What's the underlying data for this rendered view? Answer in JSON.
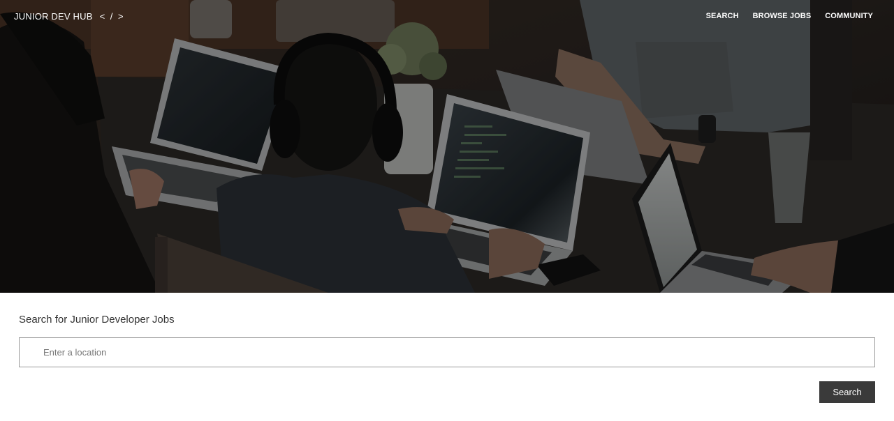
{
  "brand": {
    "name": "JUNIOR DEV HUB",
    "code_glyph": "< / >"
  },
  "nav": {
    "items": [
      {
        "label": "SEARCH"
      },
      {
        "label": "BROWSE JOBS"
      },
      {
        "label": "COMMUNITY"
      }
    ]
  },
  "hero": {
    "image_description_icon": "team-coding-photo"
  },
  "search": {
    "heading": "Search for Junior Developer Jobs",
    "location_placeholder": "Enter a location",
    "location_value": "",
    "button_label": "Search"
  },
  "colors": {
    "button_bg": "#3a3a3a",
    "input_border": "#999999",
    "heading_text": "#333333"
  }
}
